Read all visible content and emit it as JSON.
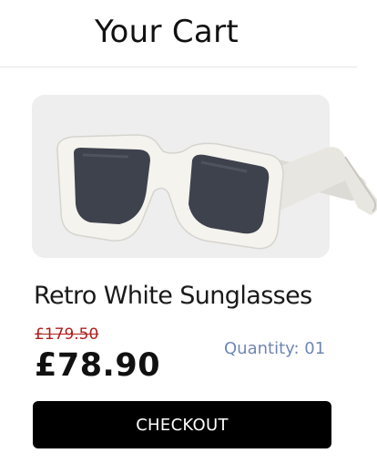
{
  "header": {
    "title": "Your Cart"
  },
  "product": {
    "image_icon": "sunglasses-image",
    "name": "Retro White Sunglasses",
    "old_price": "£179.50",
    "price": "£78.90",
    "quantity_label": "Quantity: 01"
  },
  "actions": {
    "checkout_label": "CHECKOUT"
  },
  "colors": {
    "accent": "#000000",
    "old_price": "#b0201c",
    "quantity": "#6f86b4",
    "card_bg": "#eeeeee"
  }
}
